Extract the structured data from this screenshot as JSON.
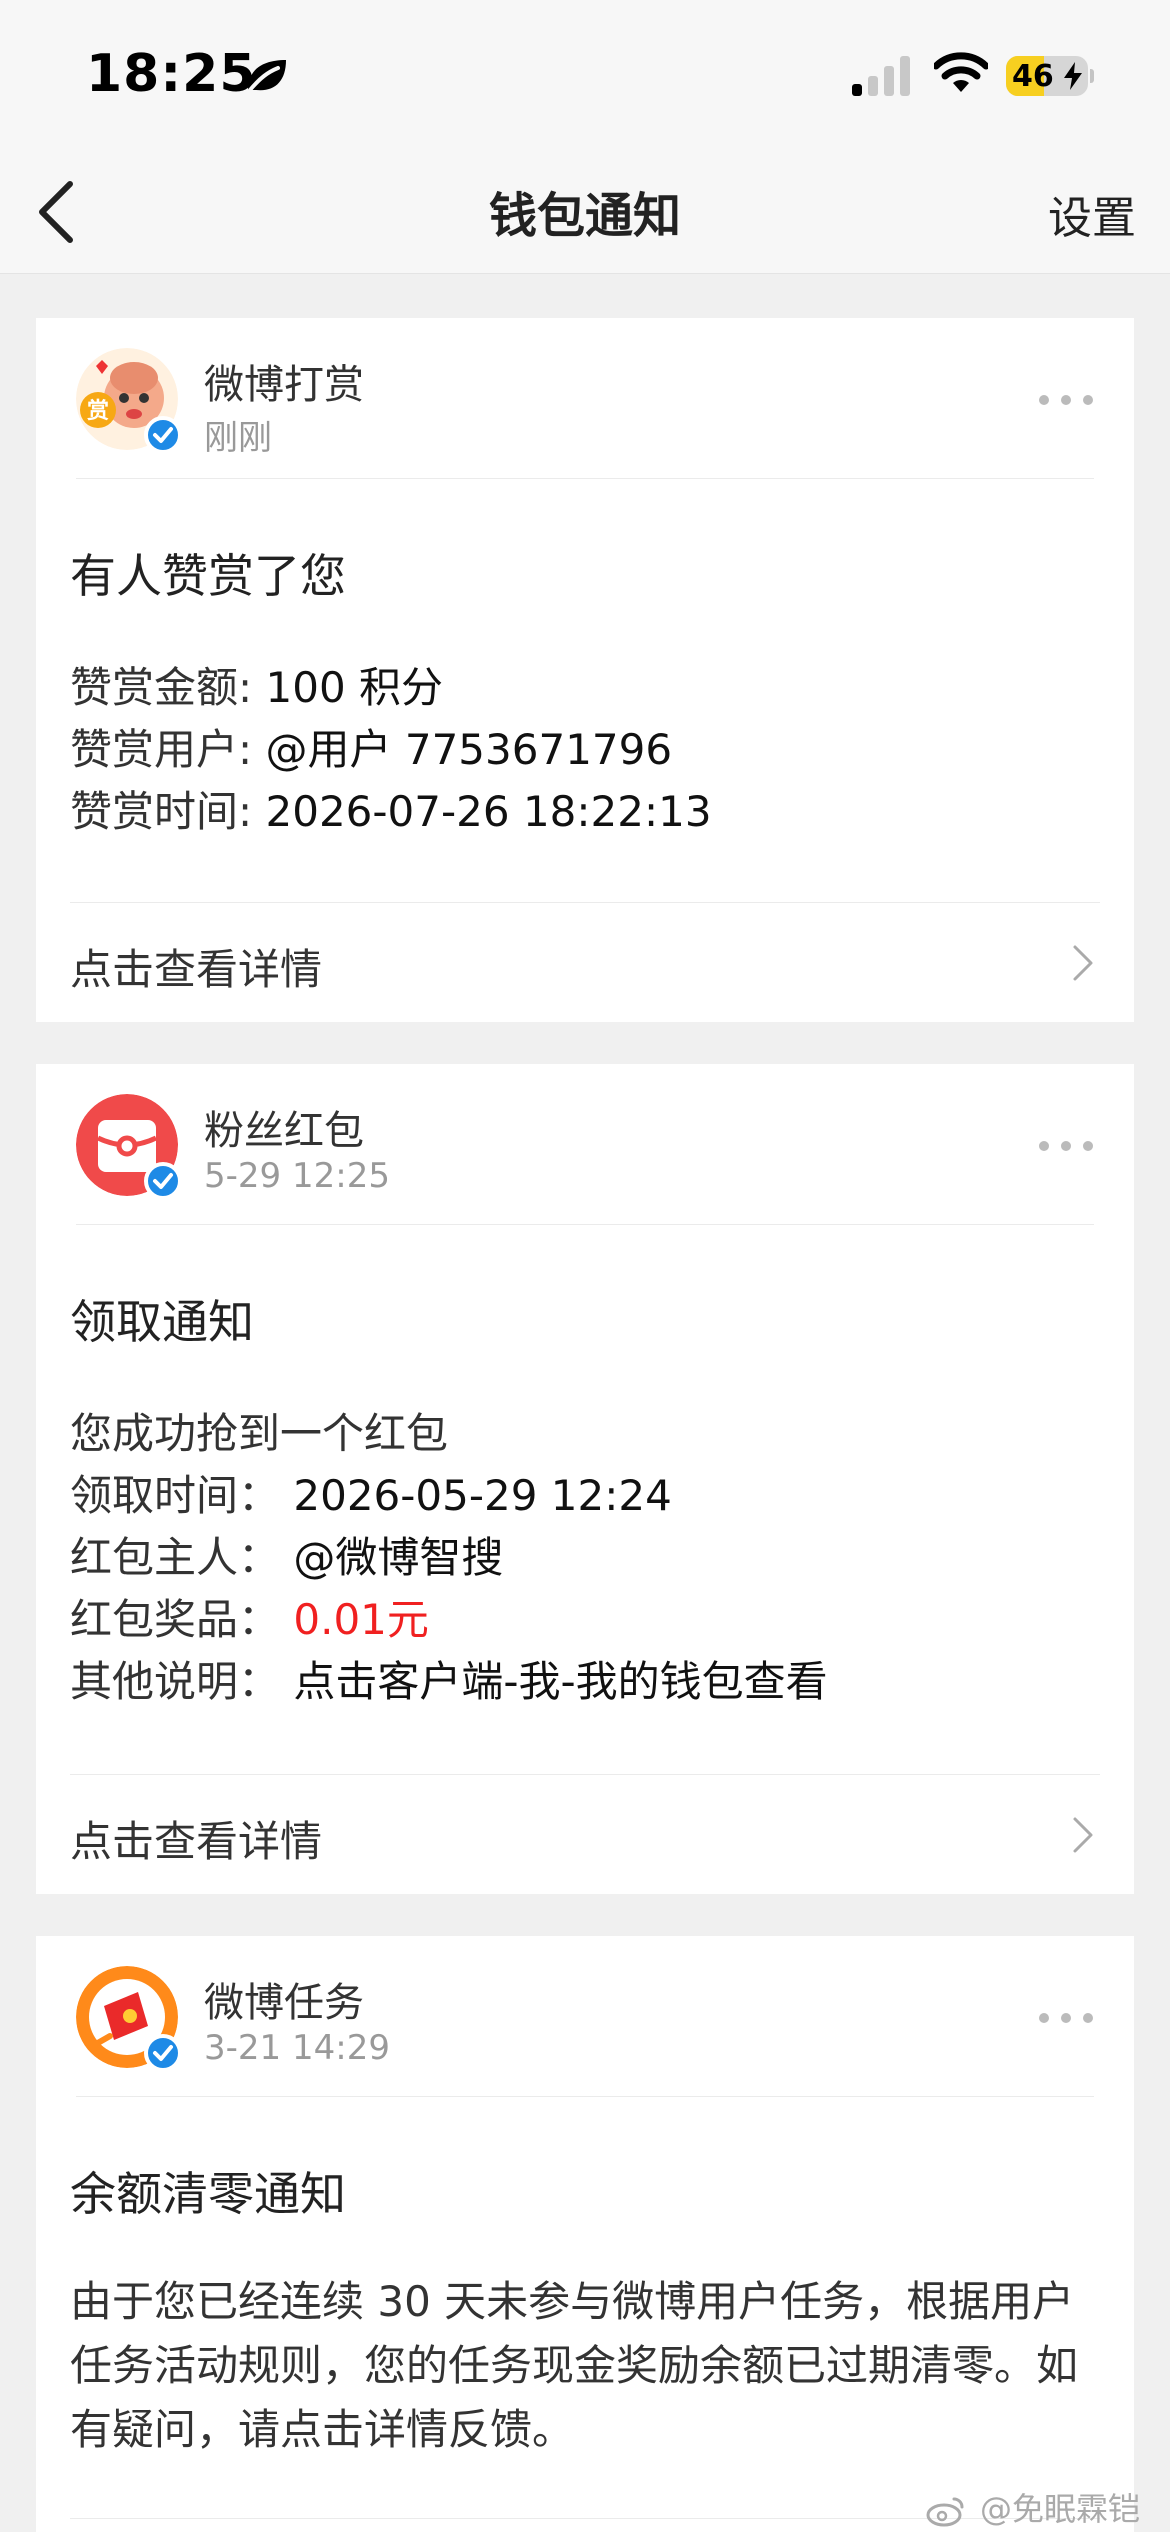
{
  "status_bar": {
    "time": "18:25",
    "battery": "46",
    "battery_level": 0.46,
    "signal_bars_active": 1
  },
  "nav": {
    "title": "钱包通知",
    "settings": "设置"
  },
  "cards": [
    {
      "sender": "微博打赏",
      "time": "刚刚",
      "title": "有人赞赏了您",
      "lines": [
        {
          "label": "赞赏金额:",
          "value": "100 积分"
        },
        {
          "label": "赞赏用户:",
          "value": "@用户 7753671796"
        },
        {
          "label": "赞赏时间:",
          "value": "2026-07-26 18:22:13"
        }
      ],
      "detail": "点击查看详情"
    },
    {
      "sender": "粉丝红包",
      "time": "5-29 12:25",
      "title": "领取通知",
      "intro": "您成功抢到一个红包",
      "lines": [
        {
          "label": "领取时间：",
          "value": "2026-05-29 12:24"
        },
        {
          "label": "红包主人：",
          "value": "@微博智搜"
        },
        {
          "label": "红包奖品：",
          "value": "0.01元"
        },
        {
          "label": "其他说明：",
          "value": "点击客户端-我-我的钱包查看"
        }
      ],
      "detail": "点击查看详情"
    },
    {
      "sender": "微博任务",
      "time": "3-21 14:29",
      "title": "余额清零通知",
      "body": "由于您已经连续 30 天未参与微博用户任务，根据用户任务活动规则，您的任务现金奖励余额已过期清零。如有疑问，请点击详情反馈。"
    }
  ],
  "watermark": "@免眠霖铠",
  "colors": {
    "accent_red": "#f02020",
    "verified_blue": "#1e8ae6",
    "battery_yellow": "#f7cf20"
  },
  "icons": {
    "avatar_1": "reward-icon",
    "avatar_2": "red-envelope-icon",
    "avatar_3": "task-envelope-icon"
  }
}
